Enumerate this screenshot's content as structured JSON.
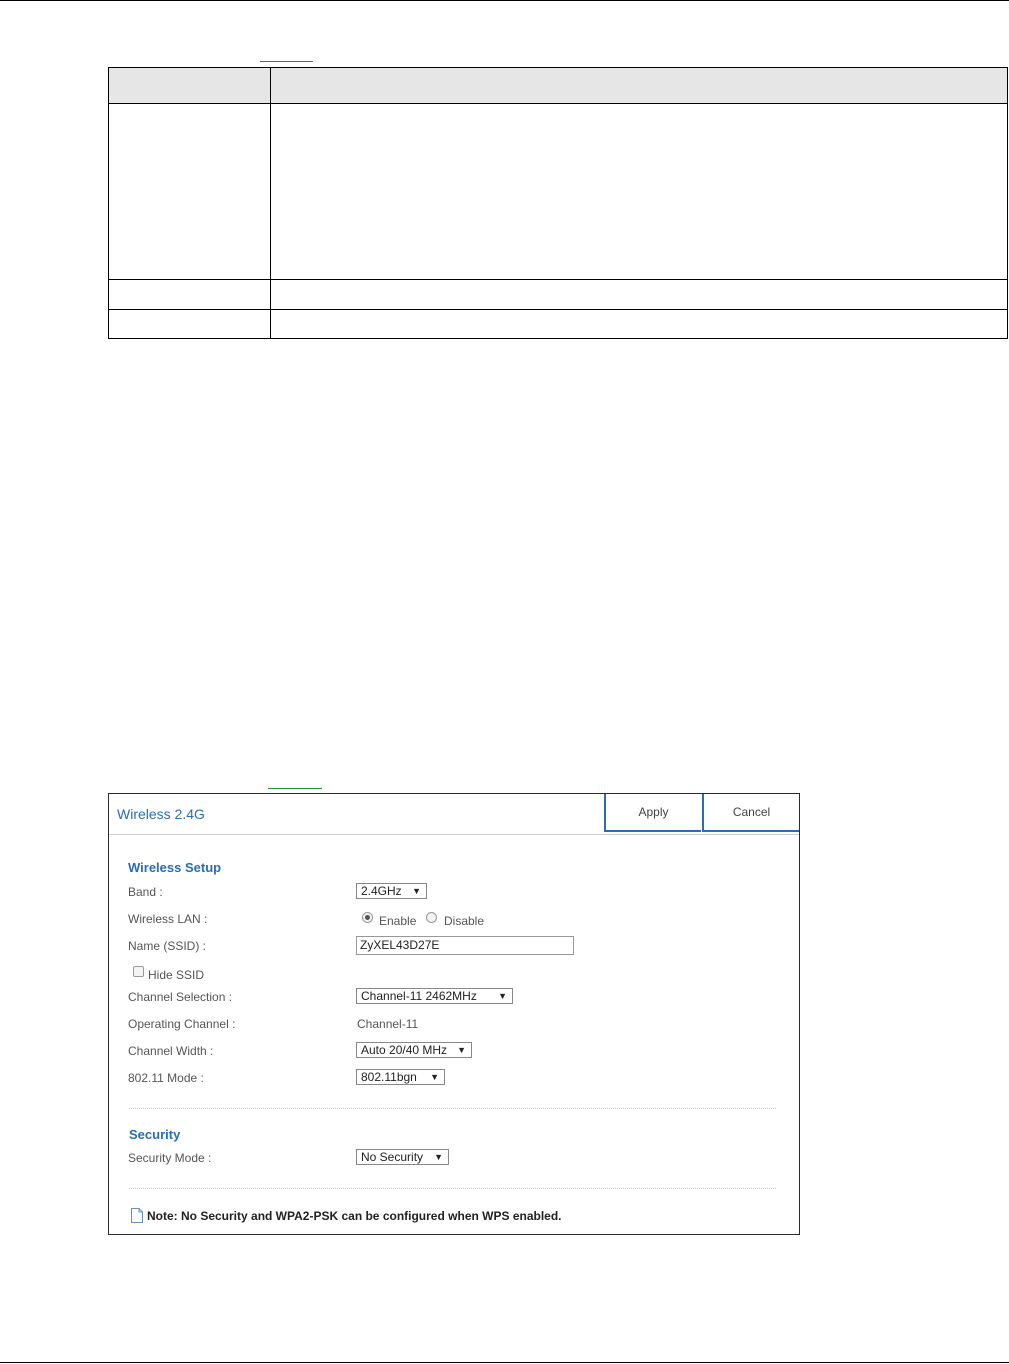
{
  "panel": {
    "title": "Wireless 2.4G",
    "apply_label": "Apply",
    "cancel_label": "Cancel"
  },
  "wireless_setup": {
    "title": "Wireless Setup",
    "band_label": "Band :",
    "band_value": "2.4GHz",
    "wireless_lan_label": "Wireless LAN :",
    "enable_label": "Enable",
    "disable_label": "Disable",
    "wireless_lan_selected": "Enable",
    "ssid_label": "Name (SSID) :",
    "ssid_value": "ZyXEL43D27E",
    "hide_ssid_label": "Hide SSID",
    "channel_selection_label": "Channel Selection :",
    "channel_selection_value": "Channel-11 2462MHz",
    "operating_channel_label": "Operating Channel :",
    "operating_channel_value": "Channel-11",
    "channel_width_label": "Channel Width :",
    "channel_width_value": "Auto 20/40 MHz",
    "mode_label": "802.11 Mode :",
    "mode_value": "802.11bgn"
  },
  "security": {
    "title": "Security",
    "mode_label": "Security Mode :",
    "mode_value": "No Security"
  },
  "note": {
    "text": "Note: No Security and WPA2-PSK can be configured when WPS enabled."
  },
  "icons": {
    "dropdown": "chevron-down-icon",
    "note": "note-icon"
  },
  "colors": {
    "accent": "#2a6db5",
    "link_underline": "#2e8b2e"
  }
}
